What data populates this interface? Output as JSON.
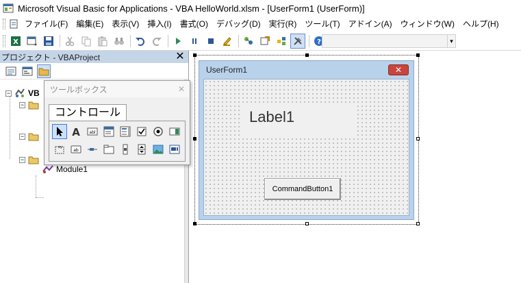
{
  "window": {
    "title": "Microsoft Visual Basic for Applications - VBA HelloWorld.xlsm - [UserForm1 (UserForm)]"
  },
  "menu": {
    "items": [
      {
        "label": "ファイル(F)"
      },
      {
        "label": "編集(E)"
      },
      {
        "label": "表示(V)"
      },
      {
        "label": "挿入(I)"
      },
      {
        "label": "書式(O)"
      },
      {
        "label": "デバッグ(D)"
      },
      {
        "label": "実行(R)"
      },
      {
        "label": "ツール(T)"
      },
      {
        "label": "アドイン(A)"
      },
      {
        "label": "ウィンドウ(W)"
      },
      {
        "label": "ヘルプ(H)"
      }
    ]
  },
  "project": {
    "title": "プロジェクト - VBAProject",
    "close_glyph": "✕",
    "root_label": "VB",
    "module_label": "Module1"
  },
  "toolbox": {
    "title": "ツールボックス",
    "close_glyph": "✕",
    "tab_label": "コントロール"
  },
  "userform": {
    "title": "UserForm1",
    "close_glyph": "✕",
    "label_text": "Label1",
    "button_text": "CommandButton1"
  },
  "colors": {
    "accent": "#3c7ad8",
    "form_frame": "#b8d2ec",
    "form_close": "#c9463d",
    "project_header": "#c5d5e8"
  }
}
